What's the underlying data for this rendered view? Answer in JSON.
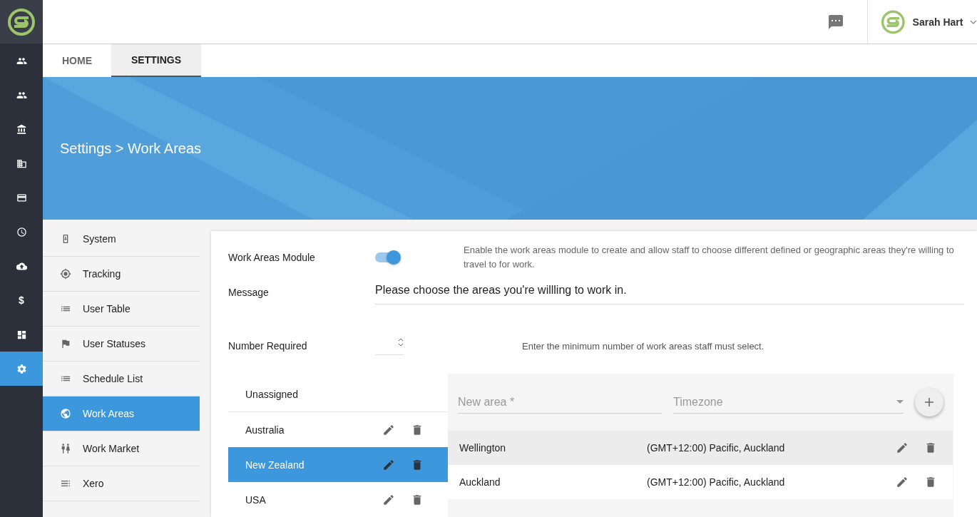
{
  "rail": [
    {
      "selected": false
    },
    {
      "selected": false
    },
    {
      "selected": false
    },
    {
      "selected": false
    },
    {
      "selected": false
    },
    {
      "selected": false
    },
    {
      "selected": false
    },
    {
      "selected": false,
      "glyph": "$"
    },
    {
      "selected": false
    },
    {
      "selected": true
    }
  ],
  "header": {
    "user_name": "Sarah Hart"
  },
  "tabs": [
    {
      "label": "HOME",
      "selected": false
    },
    {
      "label": "SETTINGS",
      "selected": true
    }
  ],
  "banner": {
    "breadcrumb": "Settings > Work Areas"
  },
  "settings_menu": [
    {
      "label": "System",
      "selected": false
    },
    {
      "label": "Tracking",
      "selected": false
    },
    {
      "label": "User Table",
      "selected": false
    },
    {
      "label": "User Statuses",
      "selected": false
    },
    {
      "label": "Schedule List",
      "selected": false
    },
    {
      "label": "Work Areas",
      "selected": true
    },
    {
      "label": "Work Market",
      "selected": false
    },
    {
      "label": "Xero",
      "selected": false
    }
  ],
  "module": {
    "label": "Work Areas Module",
    "on": true,
    "description": "Enable the work areas module to create and allow staff to choose different defined or geographic areas they're willing to travel to for work."
  },
  "message": {
    "label": "Message",
    "value": "Please choose the areas you're willling to work in."
  },
  "number_required": {
    "label": "Number Required",
    "hint": "Enter the minimum number of work areas staff must select."
  },
  "groups": [
    {
      "name": "Unassigned",
      "selected": false,
      "editable": false
    },
    {
      "name": "Australia",
      "selected": false,
      "editable": true
    },
    {
      "name": "New Zealand",
      "selected": true,
      "editable": true
    },
    {
      "name": "USA",
      "selected": false,
      "editable": true
    }
  ],
  "new_area": {
    "placeholder": "New area *",
    "timezone_placeholder": "Timezone"
  },
  "areas": [
    {
      "name": "Wellington",
      "timezone": "(GMT+12:00) Pacific, Auckland",
      "selected": true
    },
    {
      "name": "Auckland",
      "timezone": "(GMT+12:00) Pacific, Auckland",
      "selected": false
    }
  ]
}
